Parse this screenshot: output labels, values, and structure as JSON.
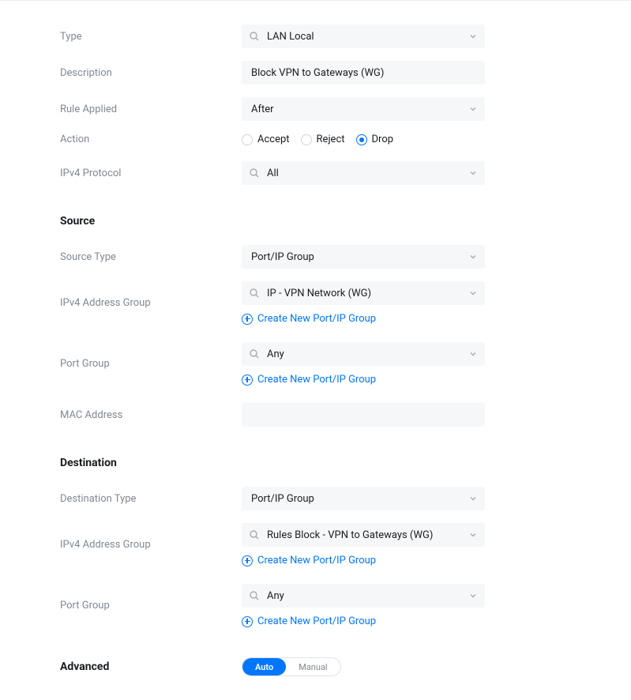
{
  "labels": {
    "type": "Type",
    "description": "Description",
    "rule_applied": "Rule Applied",
    "action": "Action",
    "ipv4_protocol": "IPv4 Protocol",
    "source_type": "Source Type",
    "ipv4_address_group": "IPv4 Address Group",
    "port_group": "Port Group",
    "mac_address": "MAC Address",
    "destination_type": "Destination Type"
  },
  "sections": {
    "source": "Source",
    "destination": "Destination",
    "advanced": "Advanced"
  },
  "values": {
    "type": "LAN Local",
    "description": "Block VPN to Gateways (WG)",
    "rule_applied": "After",
    "ipv4_protocol": "All",
    "source_type": "Port/IP Group",
    "source_ipv4_group": "IP - VPN Network (WG)",
    "source_port_group": "Any",
    "mac_address": "",
    "destination_type": "Port/IP Group",
    "destination_ipv4_group": "Rules Block - VPN to Gateways (WG)",
    "destination_port_group": "Any"
  },
  "action_options": {
    "accept": "Accept",
    "reject": "Reject",
    "drop": "Drop"
  },
  "action_selected": "drop",
  "links": {
    "create_group": "Create New Port/IP Group"
  },
  "advanced_toggle": {
    "auto": "Auto",
    "manual": "Manual"
  }
}
